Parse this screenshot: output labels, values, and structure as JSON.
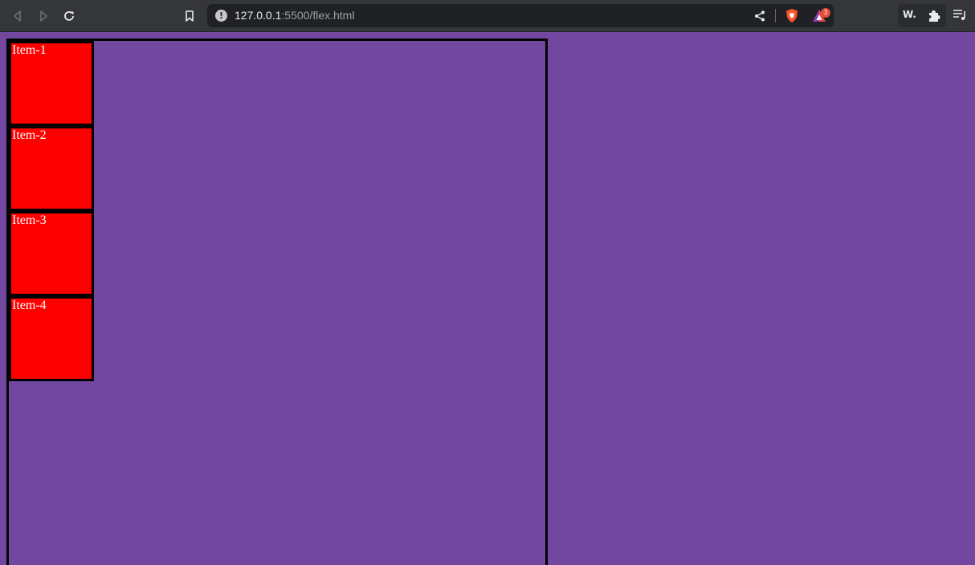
{
  "browser": {
    "url_host": "127.0.0.1",
    "url_path": ":5500/flex.html",
    "rewards_badge_count": "3",
    "extension_label": "W."
  },
  "page": {
    "background_color": "#7247a0",
    "item_color": "#ff0000",
    "items": [
      {
        "label": "Item-1"
      },
      {
        "label": "Item-2"
      },
      {
        "label": "Item-3"
      },
      {
        "label": "Item-4"
      }
    ]
  }
}
